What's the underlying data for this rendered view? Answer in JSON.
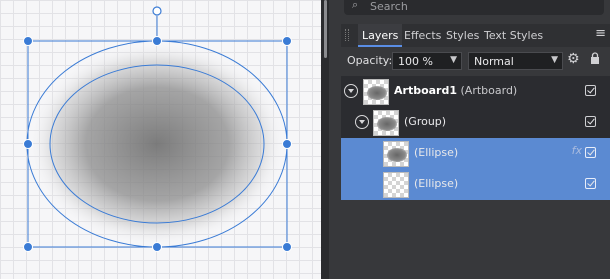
{
  "search": {
    "placeholder": "Search",
    "icon": "search-icon"
  },
  "tabs": [
    {
      "label": "Layers",
      "active": true
    },
    {
      "label": "Effects",
      "active": false
    },
    {
      "label": "Styles",
      "active": false
    },
    {
      "label": "Text Styles",
      "active": false
    }
  ],
  "options": {
    "opacity_label": "Opacity:",
    "opacity_value": "100 %",
    "blend_mode": "Normal"
  },
  "layers": [
    {
      "name": "Artboard1",
      "type": "(Artboard)",
      "checked": true
    },
    {
      "name": "(Group)",
      "checked": true
    },
    {
      "name": "(Ellipse)",
      "checked": true,
      "fx": "fx",
      "selected": true
    },
    {
      "name": "(Ellipse)",
      "checked": true,
      "selected": true
    }
  ],
  "colors": {
    "accent": "#5b8ad2",
    "selection_outline": "#3a7bd5",
    "panel_bg": "#37383b"
  }
}
